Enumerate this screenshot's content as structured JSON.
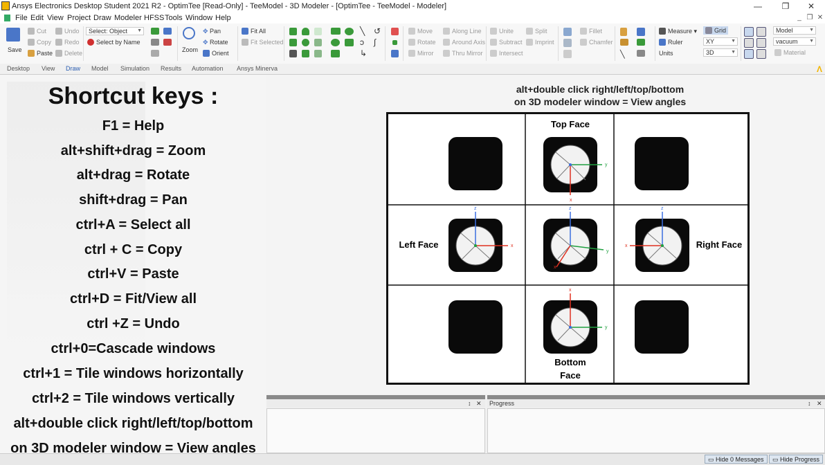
{
  "window": {
    "title": "Ansys Electronics Desktop Student 2021 R2 - OptimTee [Read-Only] - TeeModel - 3D Modeler - [OptimTee - TeeModel - Modeler]",
    "minimize": "—",
    "maximize": "❐",
    "close": "✕"
  },
  "menu": [
    "File",
    "Edit",
    "View",
    "Project",
    "Draw",
    "Modeler",
    "HFSS",
    "Tools",
    "Window",
    "Help"
  ],
  "mdi_controls": {
    "minimize": "_",
    "restore": "❐",
    "close": "✕"
  },
  "ribbon": {
    "save": "Save",
    "cut": "Cut",
    "copy": "Copy",
    "paste": "Paste",
    "undo": "Undo",
    "redo": "Redo",
    "delete": "Delete",
    "select_value": "Select: Object",
    "select_by_name": "Select by Name",
    "zoom": "Zoom",
    "pan": "Pan",
    "rotate": "Rotate",
    "orient": "Orient",
    "fit_all": "Fit All",
    "fit_selected": "Fit Selected",
    "move": "Move",
    "rotate2": "Rotate",
    "mirror": "Mirror",
    "along_line": "Along Line",
    "around_axis": "Around Axis",
    "thru_mirror": "Thru Mirror",
    "unite": "Unite",
    "subtract": "Subtract",
    "intersect": "Intersect",
    "split": "Split",
    "imprint": "Imprint",
    "fillet": "Fillet",
    "chamfer": "Chamfer",
    "measure": "Measure",
    "ruler": "Ruler",
    "units": "Units",
    "grid": "Grid",
    "plane_value": "XY",
    "dim_value": "3D",
    "model_value": "Model",
    "material_value": "vacuum",
    "material_label": "Material"
  },
  "tabs": [
    "Desktop",
    "View",
    "Draw",
    "Model",
    "Simulation",
    "Results",
    "Automation",
    "Ansys Minerva"
  ],
  "active_tab": "Draw",
  "brand_mark": "Λ",
  "shortcuts": {
    "title": "Shortcut keys :",
    "lines": [
      "F1 = Help",
      "alt+shift+drag = Zoom",
      "alt+drag = Rotate",
      "shift+drag = Pan",
      "ctrl+A = Select all",
      "ctrl + C = Copy",
      "ctrl+V = Paste",
      "ctrl+D = Fit/View all",
      "ctrl +Z = Undo",
      "ctrl+0=Cascade windows",
      "ctrl+1 = Tile windows horizontally",
      "ctrl+2 = Tile windows vertically",
      "alt+double click right/left/top/bottom",
      "on 3D modeler window = View angles"
    ]
  },
  "view_angles": {
    "title_line1": "alt+double click right/left/top/bottom",
    "title_line2": "on 3D modeler window = View angles",
    "top_face": "Top Face",
    "left_face": "Left Face",
    "right_face": "Right Face",
    "bottom_face_1": "Bottom",
    "bottom_face_2": "Face",
    "axis_x": "x",
    "axis_y": "y",
    "axis_z": "z"
  },
  "panes": {
    "progress_label": "Progress",
    "pin": "↕",
    "close": "✕"
  },
  "status": {
    "hide_messages": "Hide 0 Messages",
    "hide_progress": "Hide Progress"
  },
  "colors": {
    "axis_x": "#e03020",
    "axis_y": "#20a040",
    "axis_z": "#3a6ee0",
    "ansys_yellow": "#f2b500",
    "active_tab": "#2a5db0"
  }
}
